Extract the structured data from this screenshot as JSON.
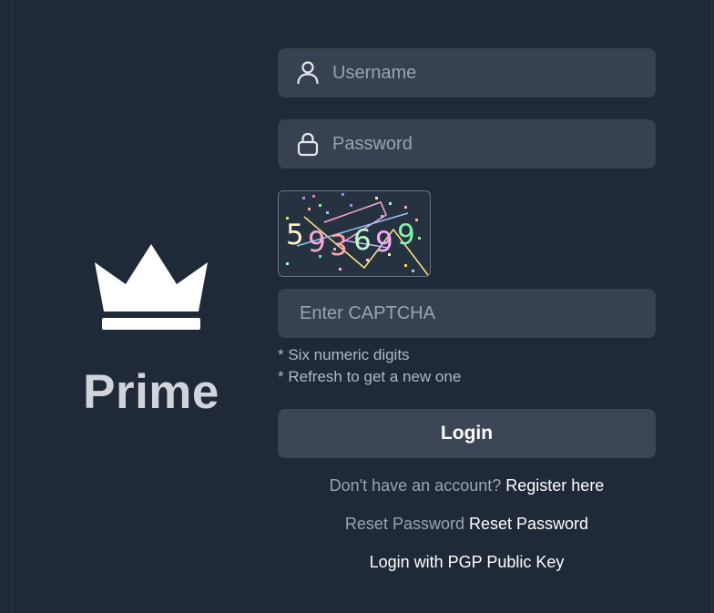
{
  "brand": {
    "name": "Prime",
    "logo_icon": "crown-icon",
    "color": "#ffffff"
  },
  "form": {
    "username": {
      "placeholder": "Username",
      "value": "",
      "icon": "user-icon"
    },
    "password": {
      "placeholder": "Password",
      "value": "",
      "icon": "lock-icon"
    },
    "captcha": {
      "image_text": "593699",
      "input_placeholder": "Enter CAPTCHA",
      "input_value": "",
      "hints": [
        "* Six numeric digits",
        "* Refresh to get a new one"
      ]
    },
    "login_button_label": "Login"
  },
  "links": {
    "register_prompt": "Don't have an account?",
    "register_link": "Register here",
    "reset_prompt": "Reset Password",
    "reset_link": "Reset Password",
    "pgp_link": "Login with PGP Public Key"
  },
  "colors": {
    "background": "#1f2937",
    "input_background": "#374151",
    "button_background": "#3b4555",
    "muted_text": "#9ca3af"
  }
}
